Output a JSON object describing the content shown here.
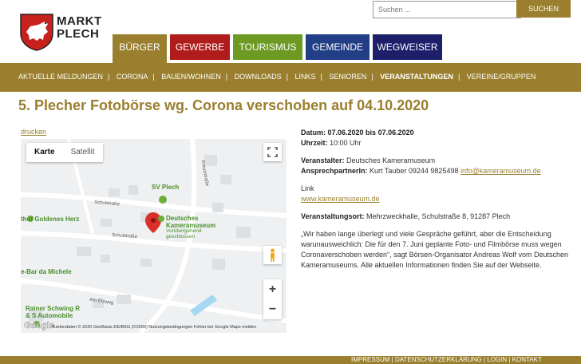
{
  "logo": {
    "line1": "MARKT",
    "line2": "PLECH"
  },
  "search": {
    "placeholder": "Suchen ...",
    "button_label": "SUCHEN"
  },
  "tabs": [
    {
      "label": "BÜRGER",
      "color": "#9a7f2e"
    },
    {
      "label": "GEWERBE",
      "color": "#b01c1c"
    },
    {
      "label": "TOURISMUS",
      "color": "#6c9a23"
    },
    {
      "label": "GEMEINDE",
      "color": "#213e86"
    },
    {
      "label": "WEGWEISER",
      "color": "#1d1f6b"
    }
  ],
  "subnav": [
    "AKTUELLE MELDUNGEN",
    "CORONA",
    "BAUEN/WOHNEN",
    "DOWNLOADS",
    "LINKS",
    "SENIOREN",
    "VERANSTALTUNGEN",
    "VEREINE/GRUPPEN"
  ],
  "page_title": "5. Plecher Fotobörse wg. Corona verschoben auf 04.10.2020",
  "print_label": "drucken",
  "map": {
    "type_map": "Karte",
    "type_satellite": "Satellit",
    "labels": {
      "sv_plech": "SV Plech",
      "museum_1": "Deutsches",
      "museum_2": "Kameramuseum",
      "museum_status_1": "Vorübergehend",
      "museum_status_2": "geschlossen",
      "hof": "thof Goldenes Herz",
      "bar": "e-Bar da Michele",
      "schwing_1": "Rainer Schwing R",
      "schwing_2": "& S Automobile",
      "schulstrasse_1": "Schulstraße",
      "schulstrasse_2": "Schulstraße",
      "kreuzstrasse": "Kreuzstraße",
      "am_etzweg": "Am Etzweg"
    },
    "attribution": "Kartendaten © 2020 GeoBasis-DE/BKG (©2009)   Nutzungsbedingungen   Fehler bei Google Maps melden",
    "google": "Google"
  },
  "event": {
    "datum_label": "Datum:",
    "datum_value": "07.06.2020 bis 07.06.2020",
    "uhrzeit_label": "Uhrzeit:",
    "uhrzeit_value": "10:00 Uhr",
    "veranstalter_label": "Veranstalter:",
    "veranstalter_value": "Deutsches Kameramuseum",
    "ansprech_label": "AnsprechpartnerIn:",
    "ansprech_value": "Kurt Tauber 09244 9825498",
    "email": "info@kameramuseum.de",
    "link_label": "Link",
    "link_url": "www.kameramuseum.de",
    "ort_label": "Veranstaltungsort:",
    "ort_value": "Mehrzweckhalle, Schulstraße 8, 91287 Plech",
    "description": "„Wir haben lange überlegt und viele Gespräche geführt, aber die Entscheidung warunausweichlich: Die für den 7. Juni geplante Foto- und Filmbörse muss wegen Coronaverschoben werden“, sagt Börsen-Organisator Andreas Wolf vom Deutschen Kameramuseums. Alle aktuellen Informationen finden Sie auf der Webseite."
  },
  "footer": {
    "links": "IMPRESSUM  |  DATENSCHUTZERKLÄRUNG  |  LOGIN  |  KONTAKT"
  }
}
